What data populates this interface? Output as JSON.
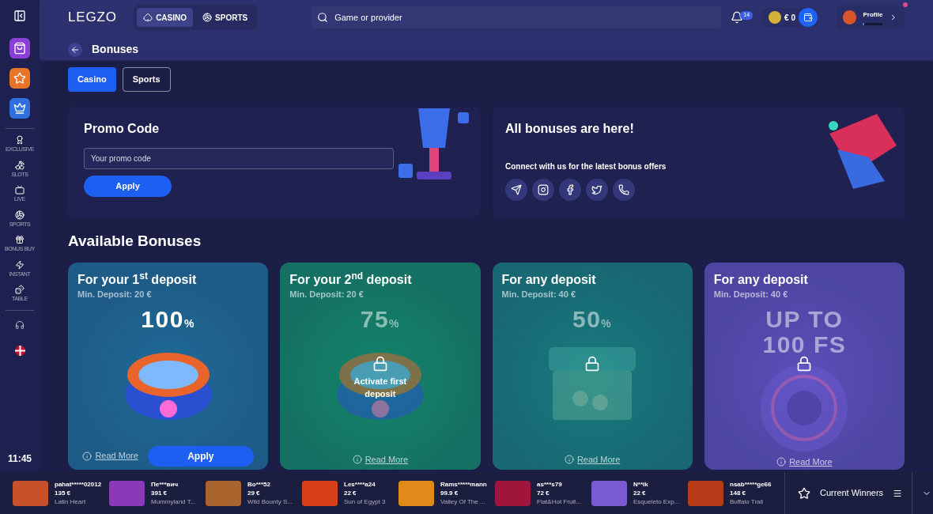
{
  "header": {
    "logo": "LEGZO",
    "tabs": [
      {
        "label": "CASINO",
        "selected": true
      },
      {
        "label": "SPORTS",
        "selected": false
      }
    ],
    "search": {
      "placeholder": "Game or provider"
    },
    "notifications": "14",
    "balance": "€ 0",
    "profile": {
      "label": "Profile",
      "level": 0.05,
      "unread": true
    }
  },
  "sidebar": {
    "featured": [
      {
        "color": "#8b3fd9"
      },
      {
        "color": "#e8742a"
      },
      {
        "color": "#2f6fe0"
      }
    ],
    "items": [
      {
        "label": "EXCLUSIVE"
      },
      {
        "label": "SLOTS"
      },
      {
        "label": "LIVE"
      },
      {
        "label": "SPORTS"
      },
      {
        "label": "BONUS BUY"
      },
      {
        "label": "INSTANT"
      },
      {
        "label": "TABLE"
      }
    ],
    "time": "11:45"
  },
  "page": {
    "title": "Bonuses",
    "tabs": [
      {
        "label": "Casino",
        "selected": true
      },
      {
        "label": "Sports",
        "selected": false
      }
    ]
  },
  "promo": {
    "title": "Promo Code",
    "placeholder": "Your promo code",
    "button": "Apply"
  },
  "social": {
    "title": "All bonuses are here!",
    "text": "Connect with us for the latest bonus offers"
  },
  "available": {
    "title": "Available Bonuses",
    "cards": [
      {
        "title": "For your 1$^{st}$ deposit",
        "min": "Min. Deposit: 20 €",
        "big": "100",
        "unit": "%",
        "kind": "ring",
        "color": "#1f6a96",
        "locked": false,
        "read_more": "Read More",
        "apply": "Apply"
      },
      {
        "title": "For your 2$^{nd}$ deposit",
        "min": "Min. Deposit: 20 €",
        "big": "75",
        "unit": "%",
        "kind": "ring",
        "color": "#13856a",
        "locked": true,
        "note": "Activate first deposit",
        "read_more": "Read More"
      },
      {
        "title": "For any deposit",
        "min": "Min. Deposit: 40 €",
        "big": "50",
        "unit": "%",
        "kind": "chest",
        "color": "#177b7e",
        "locked": true,
        "read_more": "Read More"
      },
      {
        "title": "For any deposit",
        "min": "Min. Deposit: 40 €",
        "big": "UP TO 100 FS",
        "kind": "wheel",
        "color": "#5a4fb8",
        "locked": true,
        "read_more": "Read More"
      }
    ]
  },
  "winners": {
    "items": [
      {
        "user": "pahat*****02012",
        "amount": "135 €",
        "game": "Latin Heart",
        "color": "#c8502a"
      },
      {
        "user": "Пе***вич",
        "amount": "391 €",
        "game": "Mummyland T...",
        "color": "#8a3ab8"
      },
      {
        "user": "Bo***52",
        "amount": "29 €",
        "game": "Wild Bounty S...",
        "color": "#a9642e"
      },
      {
        "user": "Les****a24",
        "amount": "22 €",
        "game": "Sun of Egypt 3",
        "color": "#d8401c"
      },
      {
        "user": "Rams*****mann",
        "amount": "99.9 €",
        "game": "Valley Of The ...",
        "color": "#e08a1a"
      },
      {
        "user": "as***s79",
        "amount": "72 €",
        "game": "Flat&Hot Fruit...",
        "color": "#a0153a"
      },
      {
        "user": "N**ik",
        "amount": "22 €",
        "game": "Esqueleto Exp...",
        "color": "#7a5ad0"
      },
      {
        "user": "nsab*****ge66",
        "amount": "148 €",
        "game": "Buffalo Trail",
        "color": "#b83a18"
      }
    ],
    "title": "Current Winners"
  }
}
